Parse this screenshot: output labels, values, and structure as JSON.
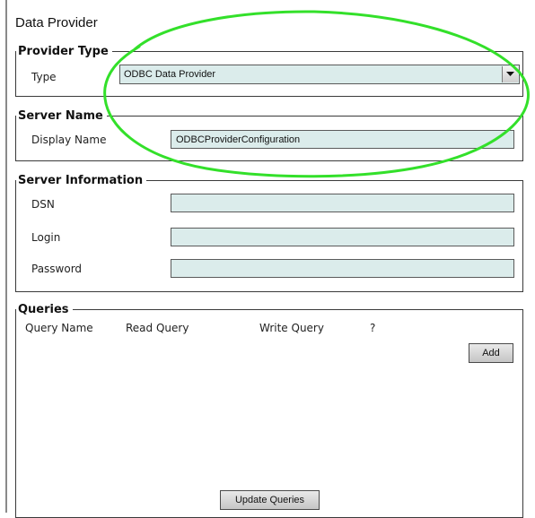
{
  "page": {
    "title": "Data Provider"
  },
  "provider_type": {
    "legend": "Provider Type",
    "type_label": "Type",
    "type_value": "ODBC Data Provider"
  },
  "server_name": {
    "legend": "Server Name",
    "display_name_label": "Display Name",
    "display_name_value": "ODBCProviderConfiguration"
  },
  "server_information": {
    "legend": "Server Information",
    "dsn_label": "DSN",
    "dsn_value": "",
    "login_label": "Login",
    "login_value": "",
    "password_label": "Password",
    "password_value": ""
  },
  "queries": {
    "legend": "Queries",
    "columns": [
      "Query Name",
      "Read Query",
      "Write Query",
      "?"
    ],
    "add_label": "Add",
    "update_label": "Update Queries"
  },
  "colors": {
    "field_bg": "#dbeceb",
    "highlight_stroke": "#33e02a"
  }
}
